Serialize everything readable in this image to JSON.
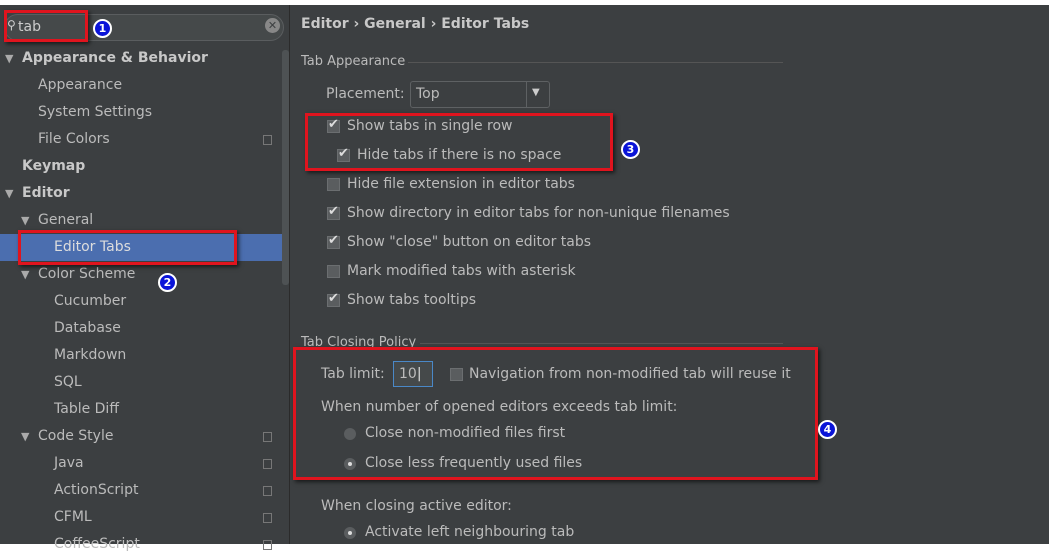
{
  "search": {
    "value": "tab"
  },
  "tree": [
    {
      "label": "Appearance & Behavior",
      "bold": true,
      "arrow": true
    },
    {
      "label": "Appearance"
    },
    {
      "label": "System Settings"
    },
    {
      "label": "File Colors",
      "copy": true
    },
    {
      "label": "Keymap",
      "bold": true
    },
    {
      "label": "Editor",
      "bold": true,
      "arrow": true
    },
    {
      "label": "General",
      "arrow": true
    },
    {
      "label": "Editor Tabs",
      "selected": true
    },
    {
      "label": "Color Scheme",
      "arrow": true
    },
    {
      "label": "Cucumber"
    },
    {
      "label": "Database"
    },
    {
      "label": "Markdown"
    },
    {
      "label": "SQL"
    },
    {
      "label": "Table Diff"
    },
    {
      "label": "Code Style",
      "arrow": true,
      "copy": true
    },
    {
      "label": "Java",
      "copy": true
    },
    {
      "label": "ActionScript",
      "copy": true
    },
    {
      "label": "CFML",
      "copy": true
    },
    {
      "label": "CoffeeScript",
      "copy": true
    }
  ],
  "breadcrumb": "Editor › General › Editor Tabs",
  "appearance": {
    "title": "Tab Appearance",
    "placement_label": "Placement:",
    "placement_value": "Top",
    "options": [
      {
        "label": "Show tabs in single row",
        "checked": true
      },
      {
        "label": "Hide tabs if there is no space",
        "checked": true
      },
      {
        "label": "Hide file extension in editor tabs",
        "checked": false
      },
      {
        "label": "Show directory in editor tabs for non-unique filenames",
        "checked": true
      },
      {
        "label": "Show \"close\" button on editor tabs",
        "checked": true
      },
      {
        "label": "Mark modified tabs with asterisk",
        "checked": false
      },
      {
        "label": "Show tabs tooltips",
        "checked": true
      }
    ]
  },
  "closing": {
    "title": "Tab Closing Policy",
    "tab_limit_label": "Tab limit:",
    "tab_limit_value": "10",
    "reuse_label": "Navigation from non-modified tab will reuse it",
    "reuse_checked": false,
    "exceeds_label": "When number of opened editors exceeds tab limit:",
    "exceeds_options": [
      {
        "label": "Close non-modified files first",
        "selected": false
      },
      {
        "label": "Close less frequently used files",
        "selected": true
      }
    ],
    "active_label": "When closing active editor:",
    "active_options": [
      {
        "label": "Activate left neighbouring tab",
        "selected": true
      }
    ]
  },
  "annotations": [
    "1",
    "2",
    "3",
    "4"
  ],
  "colors": {
    "background": "#3c3f41",
    "selection": "#4b6eaf",
    "highlight": "#e0141e",
    "badge": "#0a14d8"
  }
}
